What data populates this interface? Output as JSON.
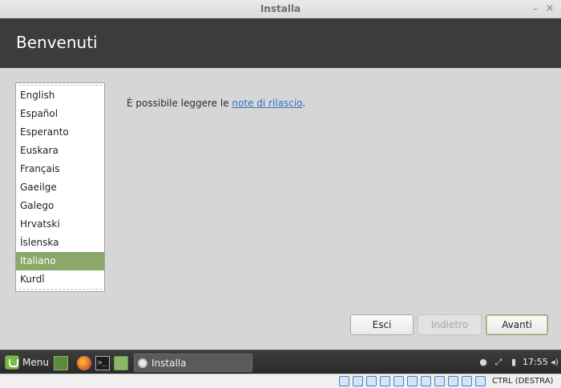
{
  "window": {
    "title": "Installa",
    "minimize_glyph": "–",
    "close_glyph": "×"
  },
  "header": {
    "title": "Benvenuti"
  },
  "languages": {
    "items": [
      "English",
      "Español",
      "Esperanto",
      "Euskara",
      "Français",
      "Gaeilge",
      "Galego",
      "Hrvatski",
      "Íslenska",
      "Italiano",
      "Kurdî"
    ],
    "selected": "Italiano"
  },
  "release_notes": {
    "prefix": "È possibile leggere le ",
    "link_text": "note di rilascio",
    "suffix": "."
  },
  "buttons": {
    "quit": "Esci",
    "back": "Indietro",
    "next": "Avanti"
  },
  "taskbar": {
    "menu_label": "Menu",
    "task_label": "Installa",
    "clock": "17:55",
    "launchers": [
      "show-desktop-icon",
      "firefox-icon",
      "terminal-icon",
      "files-icon"
    ],
    "tray_icons": [
      "user-icon",
      "network-icon",
      "power-icon",
      "volume-icon"
    ]
  },
  "vbox_status": {
    "host_key": "CTRL (DESTRA)"
  },
  "colors": {
    "accent": "#8aa86a",
    "header_bg": "#3c3c3c",
    "link": "#2f73c8"
  }
}
